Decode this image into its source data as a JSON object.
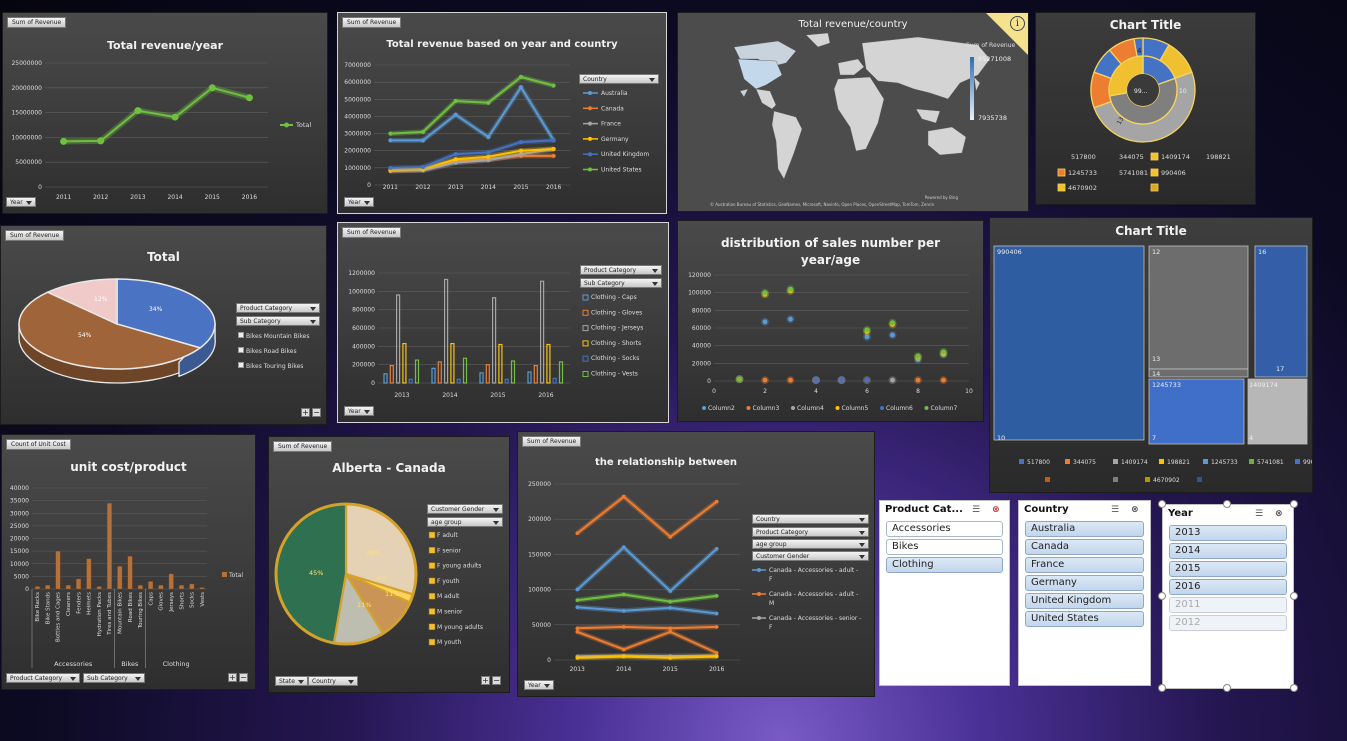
{
  "colors": {
    "green": "#6fc040",
    "blue": "#5b9bd5",
    "orange": "#ed7d31",
    "gray": "#a5a5a5",
    "gold": "#ffc000",
    "navy": "#4472c4"
  },
  "p1": {
    "field": "Sum of Revenue",
    "title": "Total revenue/year",
    "legend": "Total",
    "axis": "Year"
  },
  "p2": {
    "field": "Sum of Revenue",
    "title": "Total revenue based on year and country",
    "legend_hdr": "Country",
    "axis": "Year"
  },
  "p3": {
    "title": "Total revenue/country",
    "legend_title": "Sum of Revenue",
    "max": "85271008",
    "min": "7935738",
    "powered": "Powered by Bing",
    "credit": "© Australian Bureau of Statistics, GeoNames, Microsoft, Navinfo, Open Places, OpenStreetMap, TomTom, Zenrin",
    "info_icon": "info-icon"
  },
  "p4": {
    "title": "Chart Title",
    "ring_labels": [
      "4",
      "99...",
      "10",
      "13"
    ],
    "legend": [
      "517800",
      "344075",
      "1409174",
      "198821",
      "1245733",
      "5741081",
      "990406",
      "4670902",
      ""
    ]
  },
  "p5": {
    "field": "Sum of Revenue",
    "title": "Total",
    "pct1": "34%",
    "pct2": "54%",
    "pct3": "12%",
    "f1": "Product Category",
    "f2": "Sub Category",
    "items": [
      "Bikes Mountain Bikes",
      "Bikes Road Bikes",
      "Bikes Touring Bikes"
    ]
  },
  "p6": {
    "field": "Sum of Revenue",
    "f1": "Product Category",
    "f2": "Sub Category",
    "items": [
      "Clothing - Caps",
      "Clothing - Gloves",
      "Clothing - Jerseys",
      "Clothing - Shorts",
      "Clothing - Socks",
      "Clothing - Vests"
    ],
    "axis": "Year"
  },
  "p7": {
    "title": "distribution of sales number per year/age",
    "legend": [
      "Column2",
      "Column3",
      "Column4",
      "Column5",
      "Column6",
      "Column7"
    ]
  },
  "p8": {
    "title": "Chart Title",
    "cells": [
      "990406",
      "12",
      "16",
      "13",
      "17",
      "14",
      "1245733",
      "1409174",
      "10",
      "7",
      "4"
    ],
    "legend": [
      "517800",
      "344075",
      "1409174",
      "198821",
      "1245733",
      "5741081",
      "990406",
      "",
      "",
      "4670902",
      ""
    ]
  },
  "p9": {
    "field": "Count of Unit Cost",
    "title": "unit cost/product",
    "legend": "Total",
    "groups": [
      "Accessories",
      "Bikes",
      "Clothing"
    ],
    "f1": "Product Category",
    "f2": "Sub Category"
  },
  "p10": {
    "field": "Sum of Revenue",
    "title": "Alberta - Canada",
    "pct": [
      "45%",
      "28%",
      "4%",
      "11%",
      "11%"
    ],
    "f1": "Customer Gender",
    "f2": "age group",
    "items": [
      "F adult",
      "F senior",
      "F young adults",
      "F youth",
      "M adult",
      "M senior",
      "M young adults",
      "M youth"
    ],
    "b1": "State",
    "b2": "Country"
  },
  "p11": {
    "field": "Sum of Revenue",
    "title": "the relationship between",
    "dd": [
      "Country",
      "Product Category",
      "age group",
      "Customer Gender"
    ],
    "legend": [
      "Canada - Accessories - adult - F",
      "Canada - Accessories - adult - M",
      "Canada - Accessories - senior - F"
    ],
    "axis": "Year"
  },
  "slicers": {
    "product": {
      "title": "Product Cat...",
      "items": [
        "Accessories",
        "Bikes",
        "Clothing"
      ]
    },
    "country": {
      "title": "Country",
      "items": [
        "Australia",
        "Canada",
        "France",
        "Germany",
        "United Kingdom",
        "United States"
      ]
    },
    "year": {
      "title": "Year",
      "items": [
        "2013",
        "2014",
        "2015",
        "2016",
        "2011",
        "2012"
      ]
    }
  },
  "chart_data": [
    {
      "type": "line",
      "title": "Total revenue/year",
      "categories": [
        "2011",
        "2012",
        "2013",
        "2014",
        "2015",
        "2016"
      ],
      "series": [
        {
          "name": "Total",
          "values": [
            9200000,
            9300000,
            15400000,
            14100000,
            20000000,
            18000000
          ]
        }
      ],
      "ylim": [
        0,
        25000000
      ],
      "yticks": [
        "0",
        "5000000",
        "10000000",
        "15000000",
        "20000000",
        "25000000"
      ]
    },
    {
      "type": "line",
      "title": "Total revenue based on year and country",
      "categories": [
        "2011",
        "2012",
        "2013",
        "2014",
        "2015",
        "2016"
      ],
      "series": [
        {
          "name": "Australia",
          "values": [
            2600000,
            2600000,
            4100000,
            2800000,
            5700000,
            2600000
          ]
        },
        {
          "name": "Canada",
          "values": [
            800000,
            900000,
            1400000,
            1500000,
            1700000,
            1700000
          ]
        },
        {
          "name": "France",
          "values": [
            850000,
            850000,
            1300000,
            1450000,
            1800000,
            2100000
          ]
        },
        {
          "name": "Germany",
          "values": [
            900000,
            950000,
            1500000,
            1650000,
            2000000,
            2100000
          ]
        },
        {
          "name": "United Kingdom",
          "values": [
            1000000,
            1050000,
            1800000,
            1900000,
            2500000,
            2600000
          ]
        },
        {
          "name": "United States",
          "values": [
            3000000,
            3100000,
            4900000,
            4800000,
            6300000,
            5800000
          ]
        }
      ],
      "ylim": [
        0,
        7000000
      ],
      "yticks": [
        "0",
        "1000000",
        "2000000",
        "3000000",
        "4000000",
        "5000000",
        "6000000",
        "7000000"
      ]
    },
    {
      "type": "bar",
      "categories": [
        "2013",
        "2014",
        "2015",
        "2016"
      ],
      "series": [
        {
          "name": "Clothing - Caps",
          "values": [
            100000,
            160000,
            110000,
            120000
          ]
        },
        {
          "name": "Clothing - Gloves",
          "values": [
            190000,
            230000,
            200000,
            190000
          ]
        },
        {
          "name": "Clothing - Jerseys",
          "values": [
            960000,
            1130000,
            930000,
            1110000
          ]
        },
        {
          "name": "Clothing - Shorts",
          "values": [
            430000,
            430000,
            420000,
            420000
          ]
        },
        {
          "name": "Clothing - Socks",
          "values": [
            40000,
            40000,
            40000,
            50000
          ]
        },
        {
          "name": "Clothing - Vests",
          "values": [
            250000,
            270000,
            240000,
            230000
          ]
        }
      ],
      "ylim": [
        0,
        1200000
      ],
      "yticks": [
        "0",
        "200000",
        "400000",
        "600000",
        "800000",
        "1000000",
        "1200000"
      ]
    },
    {
      "type": "scatter",
      "title": "distribution of sales number per year/age",
      "xlim": [
        0,
        10
      ],
      "ylim": [
        0,
        120000
      ],
      "yticks": [
        "0",
        "20000",
        "40000",
        "60000",
        "80000",
        "100000",
        "120000"
      ],
      "xticks": [
        "0",
        "2",
        "4",
        "6",
        "8",
        "10"
      ],
      "series": [
        {
          "name": "Column2",
          "points": [
            [
              2,
              67000
            ],
            [
              3,
              70000
            ],
            [
              6,
              50000
            ],
            [
              7,
              52000
            ],
            [
              8,
              24000
            ],
            [
              9,
              30000
            ]
          ]
        },
        {
          "name": "Column3",
          "points": [
            [
              1,
              2000
            ],
            [
              2,
              1000
            ],
            [
              3,
              1000
            ],
            [
              4,
              1000
            ],
            [
              5,
              1000
            ],
            [
              6,
              1000
            ],
            [
              8,
              1000
            ],
            [
              9,
              1000
            ]
          ]
        },
        {
          "name": "Column4",
          "points": [
            [
              1,
              2000
            ],
            [
              4,
              1000
            ],
            [
              5,
              1000
            ],
            [
              7,
              1000
            ]
          ]
        },
        {
          "name": "Column5",
          "points": [
            [
              2,
              98000
            ],
            [
              3,
              102000
            ],
            [
              6,
              56000
            ],
            [
              7,
              64000
            ],
            [
              8,
              27000
            ],
            [
              9,
              31000
            ]
          ]
        },
        {
          "name": "Column6",
          "points": [
            [
              4,
              1000
            ],
            [
              5,
              1000
            ],
            [
              6,
              1000
            ]
          ]
        },
        {
          "name": "Column7",
          "points": [
            [
              1,
              2000
            ],
            [
              2,
              100000
            ],
            [
              3,
              104000
            ],
            [
              6,
              58000
            ],
            [
              7,
              66000
            ],
            [
              8,
              28000
            ],
            [
              9,
              33000
            ]
          ]
        }
      ]
    },
    {
      "type": "bar",
      "title": "unit cost/product",
      "categories": [
        "Bike Racks",
        "Bike Stands",
        "Bottles and Cages",
        "Cleaners",
        "Fenders",
        "Helmets",
        "Hydration Packs",
        "Tires and Tubes",
        "Mountain Bikes",
        "Road Bikes",
        "Touring Bikes",
        "Caps",
        "Gloves",
        "Jerseys",
        "Shorts",
        "Socks",
        "Vests"
      ],
      "series": [
        {
          "name": "Total",
          "values": [
            1000,
            1500,
            15000,
            1500,
            4000,
            12000,
            1000,
            34000,
            9000,
            13000,
            1500,
            3000,
            1500,
            6000,
            1500,
            2000,
            600
          ]
        }
      ],
      "ylim": [
        0,
        40000
      ],
      "yticks": [
        "0",
        "5000",
        "10000",
        "15000",
        "20000",
        "25000",
        "30000",
        "35000",
        "40000"
      ]
    },
    {
      "type": "line",
      "title": "the relationship between",
      "categories": [
        "2013",
        "2014",
        "2015",
        "2016"
      ],
      "series": [
        {
          "name": "Canada - Accessories - adult - F",
          "values": [
            100000,
            160000,
            98000,
            158000
          ]
        },
        {
          "name": "Canada - Accessories - adult - M",
          "values": [
            180000,
            232000,
            175000,
            225000
          ]
        },
        {
          "name": "Canada - Accessories - senior - F",
          "values": [
            5000,
            6000,
            5500,
            6000
          ]
        },
        {
          "name": "",
          "values": [
            85000,
            93000,
            83000,
            91000
          ]
        },
        {
          "name": "",
          "values": [
            75000,
            70000,
            74000,
            66000
          ]
        },
        {
          "name": "",
          "values": [
            45000,
            47000,
            45000,
            47000
          ]
        },
        {
          "name": "",
          "values": [
            40000,
            15000,
            40000,
            10000
          ]
        },
        {
          "name": "",
          "values": [
            3000,
            5000,
            3000,
            5000
          ]
        }
      ],
      "ylim": [
        0,
        250000
      ],
      "yticks": [
        "0",
        "50000",
        "100000",
        "150000",
        "200000",
        "250000"
      ]
    }
  ]
}
